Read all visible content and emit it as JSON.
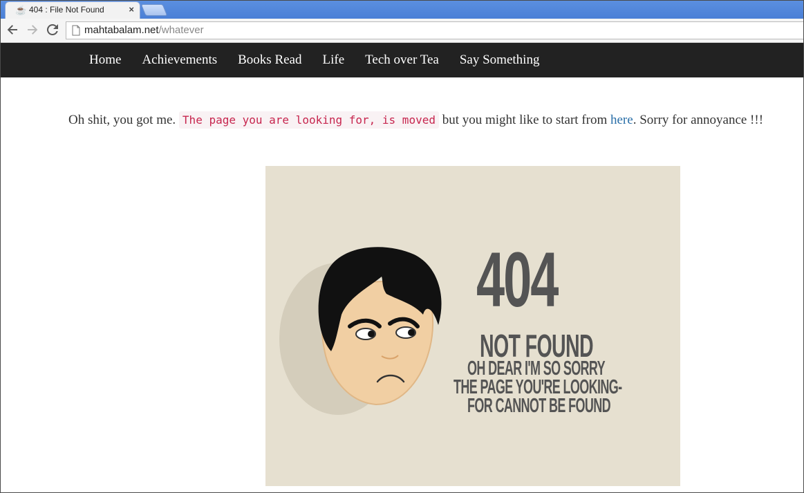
{
  "browser": {
    "tab_title": "404 : File Not Found",
    "tab_close": "×",
    "url_host": "mahtabalam.net",
    "url_path": "/whatever"
  },
  "nav": {
    "items": [
      "Home",
      "Achievements",
      "Books Read",
      "Life",
      "Tech over Tea",
      "Say Something"
    ]
  },
  "content": {
    "lead": "Oh shit, you got me. ",
    "code": "The page you are looking for, is moved",
    "middle": " but you might like to start from ",
    "link": "here",
    "end": ". Sorry for annoyance !!!"
  },
  "image": {
    "big": "404",
    "heading": "NOT FOUND",
    "line1": "OH DEAR I'M SO SORRY",
    "line2": "THE PAGE YOU'RE LOOKING-",
    "line3": "FOR CANNOT BE FOUND"
  },
  "colors": {
    "nav_bg": "#222222",
    "link": "#2a6fa8",
    "code_text": "#c7254e",
    "image_bg": "#e6e0d0"
  }
}
